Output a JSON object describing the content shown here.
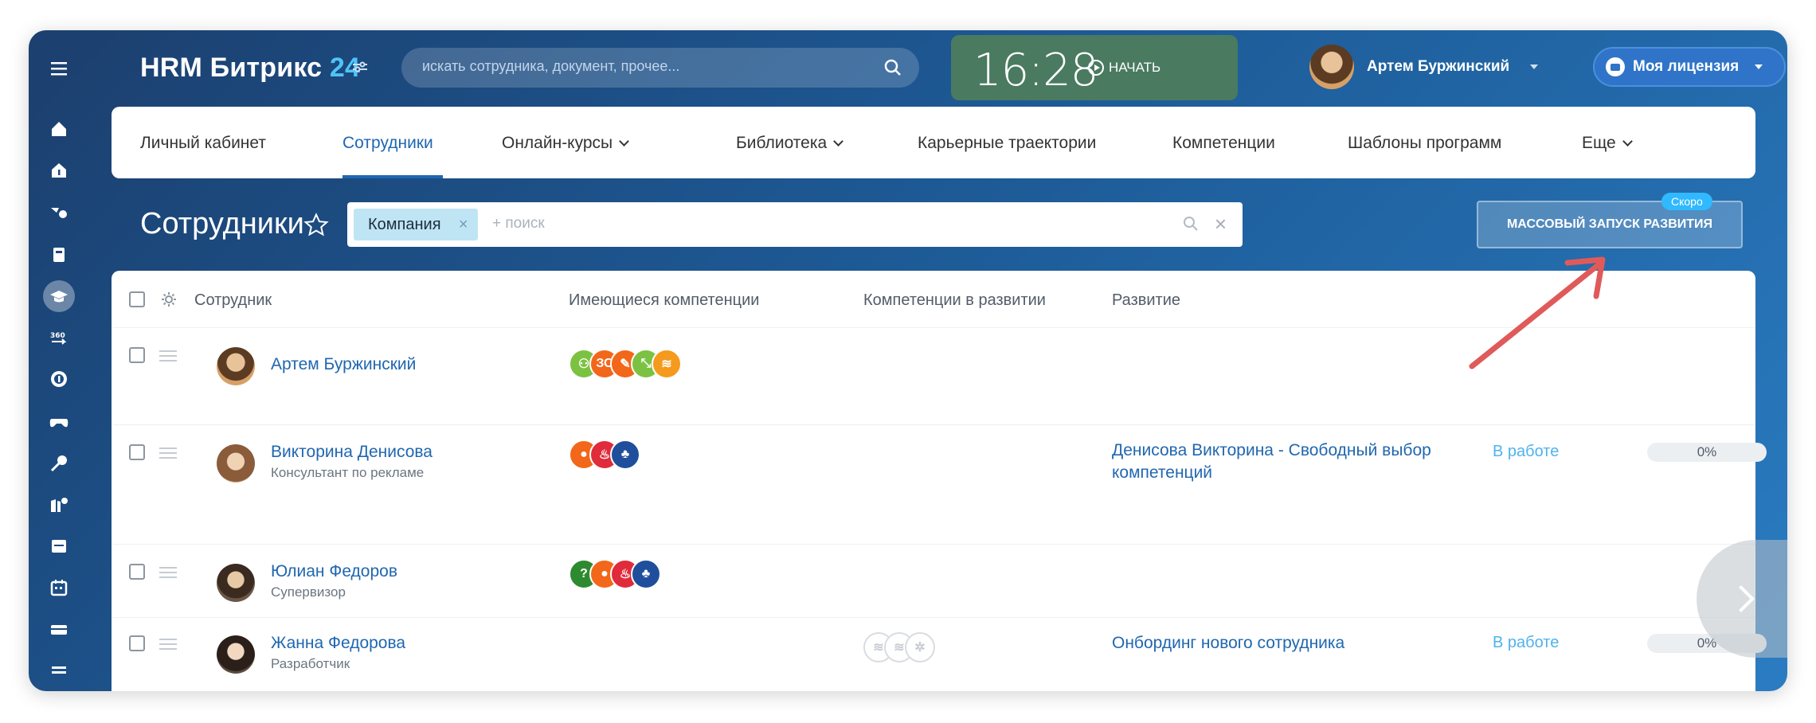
{
  "app": {
    "brand_name": "HRM Битрикс",
    "brand_number": "24"
  },
  "search": {
    "placeholder": "искать сотрудника, документ, прочее..."
  },
  "timer": {
    "time": "16:28",
    "start_label": "НАЧАТЬ"
  },
  "user": {
    "name": "Артем Буржинский"
  },
  "license": {
    "label": "Моя лицензия"
  },
  "nav": {
    "items": [
      {
        "label": "Личный кабинет"
      },
      {
        "label": "Сотрудники"
      },
      {
        "label": "Онлайн-курсы"
      },
      {
        "label": "Библиотека"
      },
      {
        "label": "Карьерные траектории"
      },
      {
        "label": "Компетенции"
      },
      {
        "label": "Шаблоны программ"
      },
      {
        "label": "Еще"
      }
    ],
    "active_index": 1
  },
  "page": {
    "title": "Сотрудники"
  },
  "filter": {
    "chip_label": "Компания",
    "placeholder": "+ поиск"
  },
  "mass_launch": {
    "label": "МАССОВЫЙ ЗАПУСК РАЗВИТИЯ",
    "badge": "Скоро"
  },
  "table": {
    "headers": {
      "employee": "Сотрудник",
      "competencies": "Имеющиеся компетенции",
      "in_development": "Компетенции в развитии",
      "development": "Развитие"
    },
    "rows": [
      {
        "name": "Артем Буржинский",
        "position": "",
        "development": "",
        "status": "",
        "progress": ""
      },
      {
        "name": "Викторина Денисова",
        "position": "Консультант по рекламе",
        "development": "Денисова Викторина - Свободный выбор компетенций",
        "status": "В работе",
        "progress": "0%"
      },
      {
        "name": "Юлиан Федоров",
        "position": "Супервизор",
        "development": "",
        "status": "",
        "progress": ""
      },
      {
        "name": "Жанна Федорова",
        "position": "Разработчик",
        "development": "Онбординг нового сотрудника",
        "status": "В работе",
        "progress": "0%"
      }
    ]
  },
  "colors": {
    "accent": "#2067b0",
    "status": "#4fb2ee",
    "soon_badge": "#30b9ff",
    "arrow": "#e05a5a"
  }
}
